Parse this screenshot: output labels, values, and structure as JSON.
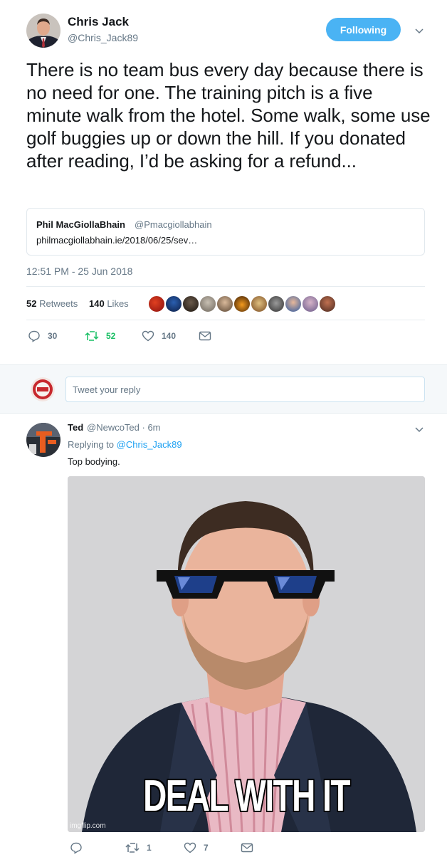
{
  "main_tweet": {
    "author_name": "Chris Jack",
    "author_handle": "@Chris_Jack89",
    "follow_label": "Following",
    "text": "There is no team bus every day because there is no need for one. The training pitch is a five minute walk from the hotel. Some walk, some use golf buggies up or down the hill. If you donated after reading, I’d be asking for a refund...",
    "quote": {
      "name": "Phil MacGiollaBhain",
      "handle": "@Pmacgiollabhain",
      "text": "philmacgiollabhain.ie/2018/06/25/sev…"
    },
    "timestamp": "12:51 PM - 25 Jun 2018",
    "stats": {
      "retweets_count": "52",
      "retweets_label": "Retweets",
      "likes_count": "140",
      "likes_label": "Likes"
    },
    "actions": {
      "replies": "30",
      "retweets": "52",
      "likes": "140"
    }
  },
  "reply_box": {
    "placeholder": "Tweet your reply"
  },
  "reply_tweet": {
    "author_name": "Ted",
    "author_handle": "@NewcoTed · 6m",
    "replying_to_label": "Replying to",
    "replying_to_handle": "@Chris_Jack89",
    "text": "Top bodying.",
    "image": {
      "caption": "DEAL WITH IT",
      "watermark": "imgflip.com"
    },
    "actions": {
      "replies": "",
      "retweets": "1",
      "likes": "7"
    }
  },
  "colors": {
    "follow_button": "#4ab3f4",
    "link": "#1da1f2",
    "retweet_green": "#17bf63",
    "muted": "#657786"
  },
  "icons": [
    "chevron-down-icon",
    "reply-icon",
    "retweet-icon",
    "heart-icon",
    "envelope-icon"
  ]
}
